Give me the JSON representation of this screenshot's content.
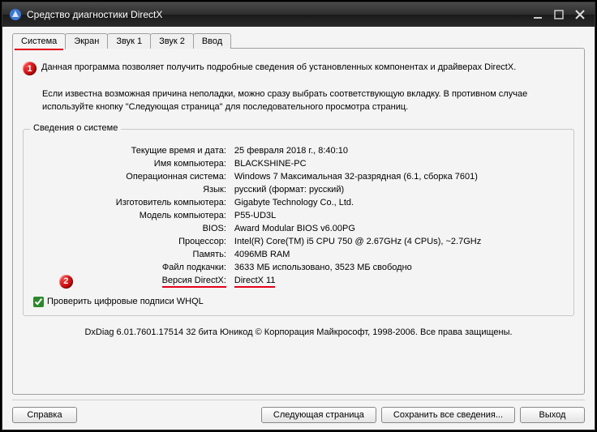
{
  "window": {
    "title": "Средство диагностики DirectX"
  },
  "tabs": {
    "system": "Система",
    "display": "Экран",
    "sound1": "Звук 1",
    "sound2": "Звук 2",
    "input": "Ввод"
  },
  "badges": {
    "one": "1",
    "two": "2"
  },
  "intro": {
    "line1": "Данная программа позволяет получить подробные сведения об установленных компонентах и драйверах DirectX.",
    "line2": "Если известна возможная причина неполадки, можно сразу выбрать соответствующую вкладку. В противном случае используйте кнопку \"Следующая страница\" для последовательного просмотра страниц."
  },
  "group": {
    "legend": "Сведения о системе"
  },
  "fields": {
    "datetime": {
      "label": "Текущие время и дата:",
      "value": "25 февраля 2018 г., 8:40:10"
    },
    "pcname": {
      "label": "Имя компьютера:",
      "value": "BLACKSHINE-PC"
    },
    "os": {
      "label": "Операционная система:",
      "value": "Windows 7 Максимальная 32-разрядная (6.1, сборка 7601)"
    },
    "lang": {
      "label": "Язык:",
      "value": "русский (формат: русский)"
    },
    "manuf": {
      "label": "Изготовитель компьютера:",
      "value": "Gigabyte Technology Co., Ltd."
    },
    "model": {
      "label": "Модель компьютера:",
      "value": "P55-UD3L"
    },
    "bios": {
      "label": "BIOS:",
      "value": "Award Modular BIOS v6.00PG"
    },
    "cpu": {
      "label": "Процессор:",
      "value": "Intel(R) Core(TM) i5 CPU       750  @ 2.67GHz (4 CPUs), ~2.7GHz"
    },
    "mem": {
      "label": "Память:",
      "value": "4096MB RAM"
    },
    "pagefile": {
      "label": "Файл подкачки:",
      "value": "3633 МБ использовано, 3523 МБ свободно"
    },
    "dxver": {
      "label": "Версия DirectX:",
      "value": "DirectX 11"
    }
  },
  "whql": {
    "label": "Проверить цифровые подписи WHQL"
  },
  "footer": "DxDiag 6.01.7601.17514 32 бита Юникод  © Корпорация Майкрософт, 1998-2006.  Все права защищены.",
  "buttons": {
    "help": "Справка",
    "next": "Следующая страница",
    "save": "Сохранить все сведения...",
    "exit": "Выход"
  }
}
